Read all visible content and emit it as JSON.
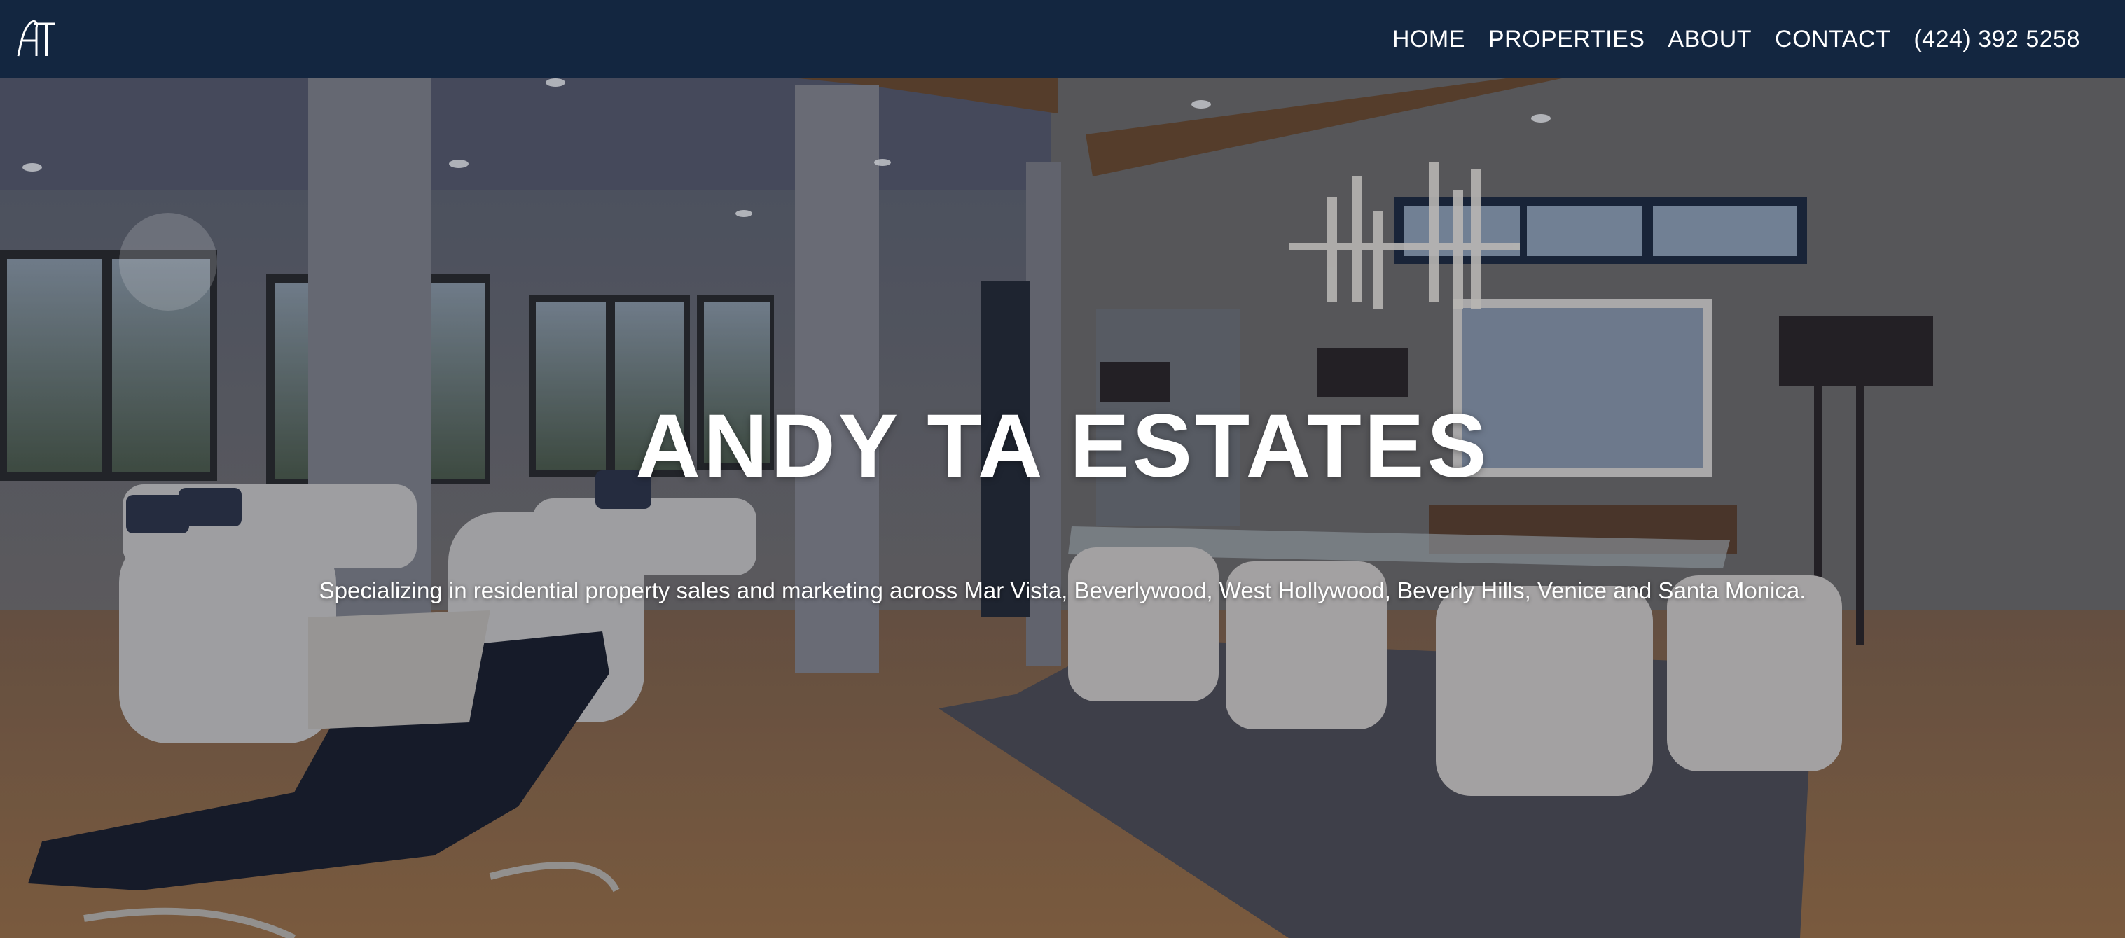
{
  "header": {
    "logo_alt": "AT",
    "background_color": "#132640",
    "nav": [
      {
        "label": "HOME"
      },
      {
        "label": "PROPERTIES"
      },
      {
        "label": "ABOUT"
      },
      {
        "label": "CONTACT"
      },
      {
        "label": "(424) 392 5258"
      }
    ]
  },
  "hero": {
    "title": "ANDY TA ESTATES",
    "subtitle": "Specializing in residential property sales and marketing across Mar Vista, Beverlywood, West Hollywood, Beverly Hills, Venice and Santa Monica.",
    "background_image": "interior-living-dining-room",
    "text_color": "#ffffff"
  }
}
